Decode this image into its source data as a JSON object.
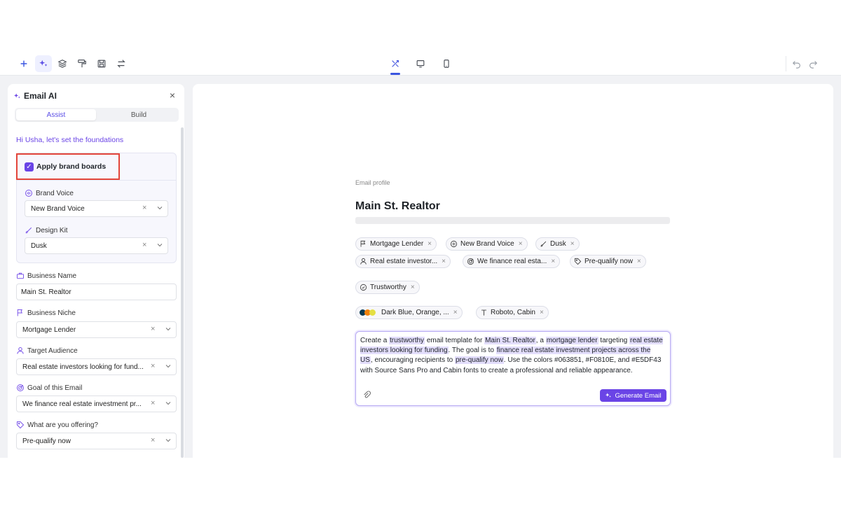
{
  "panel": {
    "title": "Email AI",
    "tabs": [
      "Assist",
      "Build"
    ],
    "greeting": "Hi Usha, let's set the foundations",
    "apply_brand_boards": "Apply brand boards",
    "brand_voice": {
      "label": "Brand Voice",
      "value": "New Brand Voice"
    },
    "design_kit": {
      "label": "Design Kit",
      "value": "Dusk"
    },
    "business_name": {
      "label": "Business Name",
      "value": "Main St. Realtor"
    },
    "business_niche": {
      "label": "Business Niche",
      "value": "Mortgage Lender"
    },
    "target_audience": {
      "label": "Target Audience",
      "value": "Real estate investors looking for fund..."
    },
    "goal": {
      "label": "Goal of this Email",
      "value": "We finance real estate investment pr..."
    },
    "offering": {
      "label": "What are you offering?",
      "value": "Pre-qualify now"
    }
  },
  "profile": {
    "eyebrow": "Email profile",
    "title": "Main St. Realtor",
    "chips": {
      "niche": "Mortgage Lender",
      "voice": "New Brand Voice",
      "kit": "Dusk",
      "audience": "Real estate investor...",
      "goal": "We finance real esta...",
      "offer": "Pre-qualify now",
      "tone": "Trustworthy",
      "colors": "Dark Blue, Orange, ...",
      "fonts": "Roboto, Cabin"
    },
    "color_dots": [
      "#063851",
      "#F0810E",
      "#E5DF43"
    ]
  },
  "prompt": {
    "p1": "Create a ",
    "h1": "trustworthy",
    "p2": " email template for ",
    "h2": "Main St. Realtor",
    "p3": ", a ",
    "h3": "mortgage lender",
    "p4": " targeting ",
    "h4": "real estate investors looking for funding",
    "p5": ". The goal is to ",
    "h5": "finance real estate investment projects across the US",
    "p6": ", encouraging recipients to ",
    "h6": "pre-qualify now",
    "p7": ". Use the colors #063851, #F0810E, and #E5DF43 with Source Sans Pro and Cabin fonts to create a professional and reliable appearance.",
    "button": "Generate Email"
  },
  "colors": {
    "accent": "#6a44e6",
    "highlight": "#e3defc",
    "callout": "#e3453a"
  }
}
